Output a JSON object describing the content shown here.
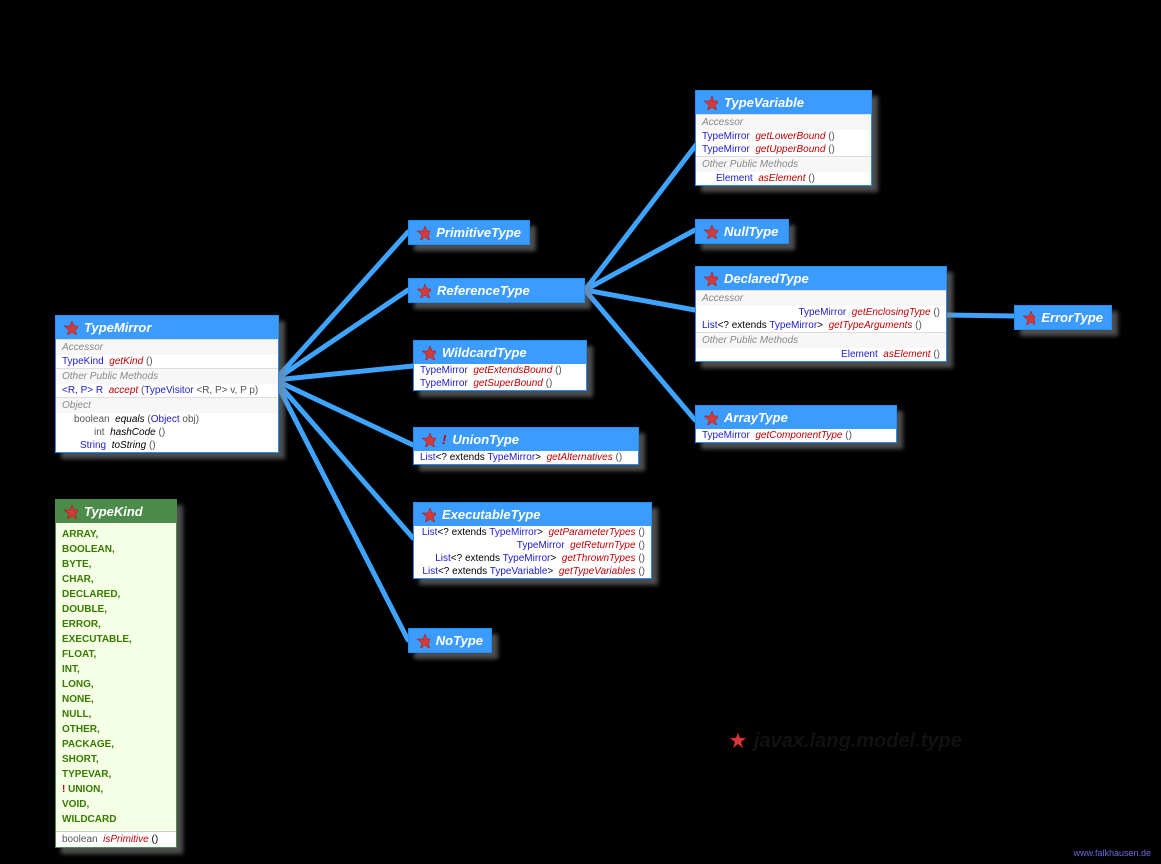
{
  "package_name": "javax.lang.model.type",
  "watermark": "www.falkhausen.de",
  "typeMirror": {
    "title": "TypeMirror",
    "sec1": "Accessor",
    "r1_ret": "TypeKind",
    "r1_nm": "getKind",
    "r1_par": "()",
    "sec2": "Other Public Methods",
    "r2_ret": "<R, P> R",
    "r2_nm": "accept",
    "r2_par": "(TypeVisitor <R, P> v, P p)",
    "sec3": "Object",
    "r3_ret": "boolean",
    "r3_nm": "equals",
    "r3_par": "(Object obj)",
    "r4_ret": "int",
    "r4_nm": "hashCode",
    "r4_par": "()",
    "r5_ret": "String",
    "r5_nm": "toString",
    "r5_par": "()"
  },
  "primitiveType": {
    "title": "PrimitiveType"
  },
  "referenceType": {
    "title": "ReferenceType"
  },
  "wildcardType": {
    "title": "WildcardType",
    "r1_ret": "TypeMirror",
    "r1_nm": "getExtendsBound",
    "r1_par": "()",
    "r2_ret": "TypeMirror",
    "r2_nm": "getSuperBound",
    "r2_par": "()"
  },
  "unionType": {
    "title": "UnionType",
    "bang": "!",
    "r1_ret": "List<? extends TypeMirror>",
    "r1_nm": "getAlternatives",
    "r1_par": "()"
  },
  "executableType": {
    "title": "ExecutableType",
    "r1_ret": "List<? extends TypeMirror>",
    "r1_nm": "getParameterTypes",
    "r1_par": "()",
    "r2_ret": "TypeMirror",
    "r2_nm": "getReturnType",
    "r2_par": "()",
    "r3_ret": "List<? extends TypeMirror>",
    "r3_nm": "getThrownTypes",
    "r3_par": "()",
    "r4_ret": "List<? extends TypeVariable>",
    "r4_nm": "getTypeVariables",
    "r4_par": "()"
  },
  "noType": {
    "title": "NoType"
  },
  "typeVariable": {
    "title": "TypeVariable",
    "sec1": "Accessor",
    "r1_ret": "TypeMirror",
    "r1_nm": "getLowerBound",
    "r1_par": "()",
    "r2_ret": "TypeMirror",
    "r2_nm": "getUpperBound",
    "r2_par": "()",
    "sec2": "Other Public Methods",
    "r3_ret": "Element",
    "r3_nm": "asElement",
    "r3_par": "()"
  },
  "nullType": {
    "title": "NullType"
  },
  "declaredType": {
    "title": "DeclaredType",
    "sec1": "Accessor",
    "r1_ret": "TypeMirror",
    "r1_nm": "getEnclosingType",
    "r1_par": "()",
    "r2_ret": "List<? extends TypeMirror>",
    "r2_nm": "getTypeArguments",
    "r2_par": "()",
    "sec2": "Other Public Methods",
    "r3_ret": "Element",
    "r3_nm": "asElement",
    "r3_par": "()"
  },
  "arrayType": {
    "title": "ArrayType",
    "r1_ret": "TypeMirror",
    "r1_nm": "getComponentType",
    "r1_par": "()"
  },
  "errorType": {
    "title": "ErrorType"
  },
  "typeKind": {
    "title": "TypeKind",
    "items": [
      "ARRAY,",
      "BOOLEAN,",
      "BYTE,",
      "CHAR,",
      "DECLARED,",
      "DOUBLE,",
      "ERROR,",
      "EXECUTABLE,",
      "FLOAT,",
      "INT,",
      "LONG,",
      "NONE,",
      "NULL,",
      "OTHER,",
      "PACKAGE,",
      "SHORT,",
      "TYPEVAR,",
      "! UNION,",
      "VOID,",
      "WILDCARD"
    ],
    "f_ret": "boolean",
    "f_nm": "isPrimitive",
    "f_par": "()"
  }
}
